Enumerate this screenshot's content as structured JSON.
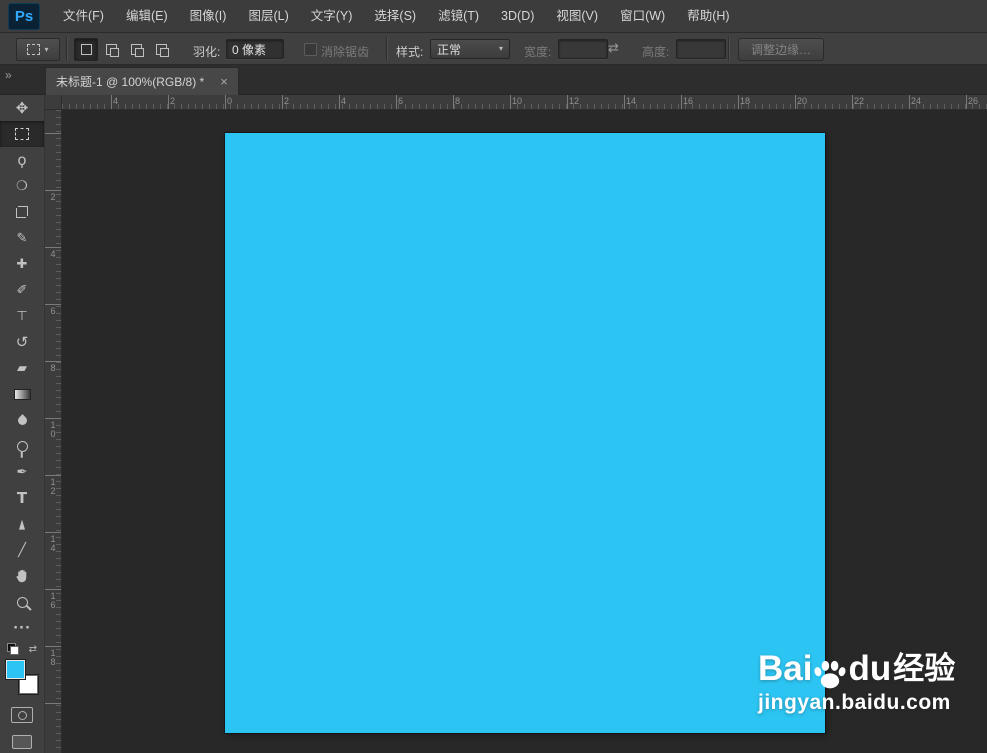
{
  "menu": {
    "logo": "Ps",
    "items": [
      "文件(F)",
      "编辑(E)",
      "图像(I)",
      "图层(L)",
      "文字(Y)",
      "选择(S)",
      "滤镜(T)",
      "3D(D)",
      "视图(V)",
      "窗口(W)",
      "帮助(H)"
    ]
  },
  "options_bar": {
    "preset_caret_icon": "▾",
    "feather_label": "羽化:",
    "feather_value": "0 像素",
    "antialias_label": "消除锯齿",
    "style_label": "样式:",
    "style_value": "正常",
    "style_caret_icon": "▾",
    "width_label": "宽度:",
    "width_value": "",
    "swap_dims_icon": "⇄",
    "height_label": "高度:",
    "height_value": "",
    "refine_edge_label": "调整边缘…"
  },
  "document_tab": {
    "title": "未标题-1 @ 100%(RGB/8) *",
    "close_icon": "×"
  },
  "rulers": {
    "horizontal_labels": [
      "4",
      "2",
      "0",
      "2",
      "4",
      "6",
      "8",
      "10",
      "12",
      "14",
      "16",
      "18",
      "20",
      "22",
      "24",
      "26"
    ],
    "vertical_labels": [
      "2",
      "4",
      "6",
      "8",
      "10",
      "12",
      "14",
      "16",
      "18"
    ]
  },
  "toolbar": {
    "collapse_icon": "»",
    "swap_colors_icon": "⇄",
    "tools": [
      {
        "name": "move-tool",
        "glyph": "✥"
      },
      {
        "name": "rectangular-marquee-tool",
        "glyph": "",
        "selected": true
      },
      {
        "name": "lasso-tool",
        "glyph": "ϙ"
      },
      {
        "name": "quick-selection-tool",
        "glyph": "❍"
      },
      {
        "name": "crop-tool",
        "glyph": ""
      },
      {
        "name": "eyedropper-tool",
        "glyph": "✎"
      },
      {
        "name": "spot-healing-brush-tool",
        "glyph": "✚"
      },
      {
        "name": "brush-tool",
        "glyph": "✐"
      },
      {
        "name": "clone-stamp-tool",
        "glyph": "⊤"
      },
      {
        "name": "history-brush-tool",
        "glyph": "↺"
      },
      {
        "name": "eraser-tool",
        "glyph": "▰"
      },
      {
        "name": "gradient-tool",
        "glyph": ""
      },
      {
        "name": "blur-tool",
        "glyph": ""
      },
      {
        "name": "dodge-tool",
        "glyph": ""
      },
      {
        "name": "pen-tool",
        "glyph": "✒"
      },
      {
        "name": "type-tool",
        "glyph": "T"
      },
      {
        "name": "path-selection-tool",
        "glyph": "▲"
      },
      {
        "name": "line-tool",
        "glyph": "╱"
      },
      {
        "name": "hand-tool",
        "glyph": ""
      },
      {
        "name": "zoom-tool",
        "glyph": ""
      },
      {
        "name": "more-tools",
        "glyph": "···"
      }
    ]
  },
  "colors": {
    "foreground": "#2cc4f2",
    "background": "#ffffff",
    "document_fill": "#2cc4f2",
    "logo_blue": "#31a8ff"
  },
  "watermark": {
    "brand_bai": "Bai",
    "brand_du": "du",
    "brand_suffix": "经验",
    "url": "jingyan.baidu.com"
  }
}
